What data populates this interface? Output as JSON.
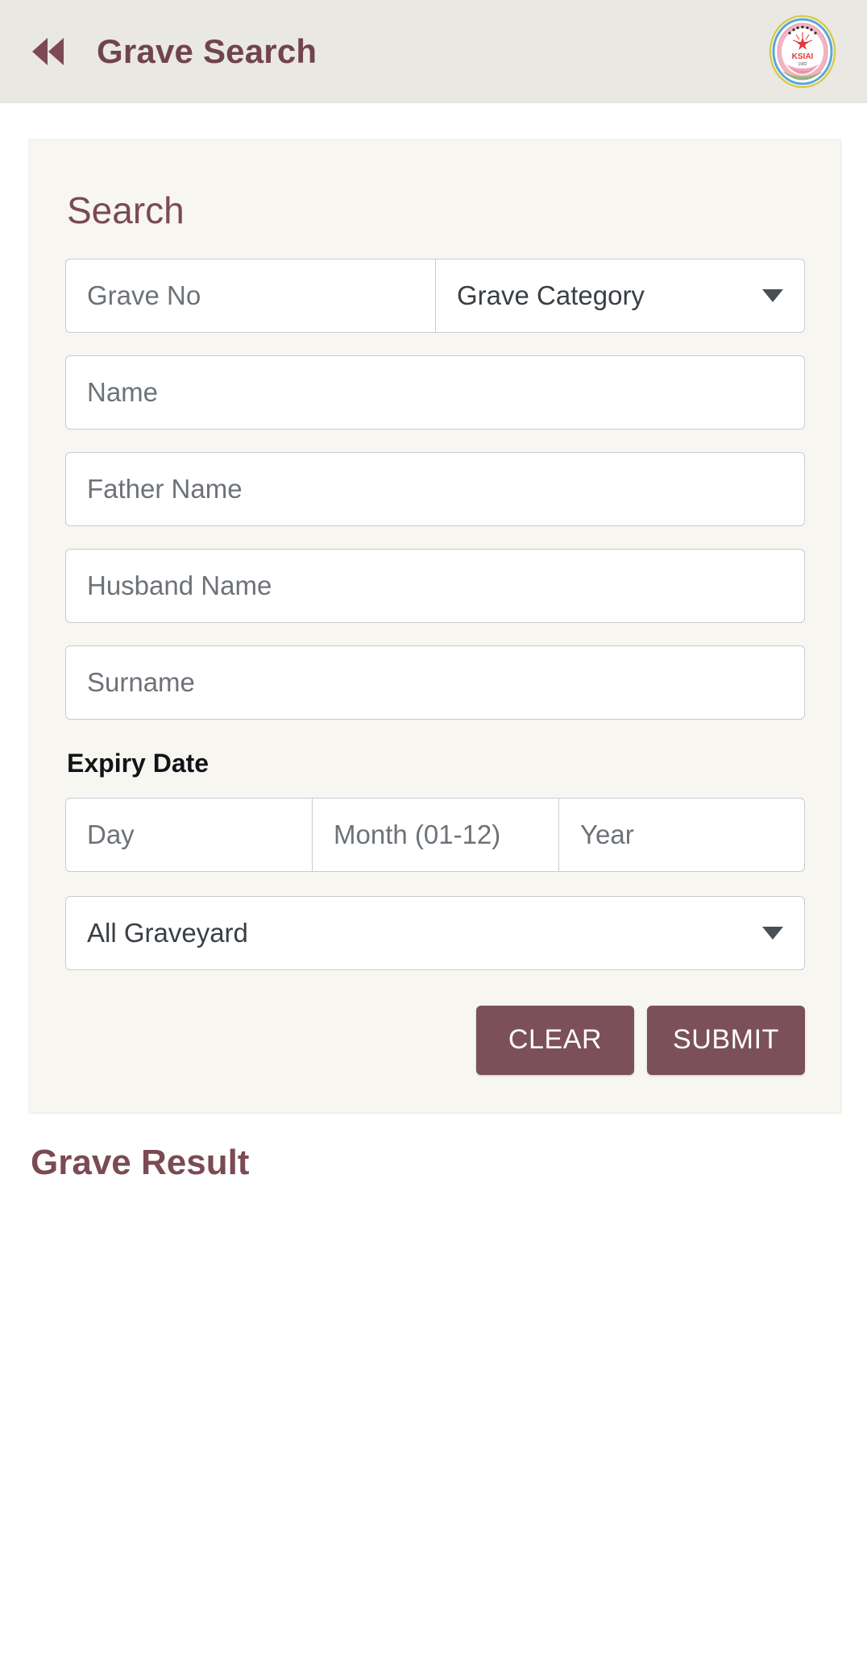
{
  "appbar": {
    "back_icon": "rewind-back-icon",
    "title": "Grave Search",
    "logo_icon": "organization-logo",
    "logo_text": "KSIAI",
    "logo_year": "1982"
  },
  "search_card": {
    "title": "Search",
    "fields": {
      "grave_no": {
        "placeholder": "Grave No",
        "value": ""
      },
      "grave_category": {
        "selected": "Grave Category"
      },
      "name": {
        "placeholder": "Name",
        "value": ""
      },
      "father_name": {
        "placeholder": "Father Name",
        "value": ""
      },
      "husband_name": {
        "placeholder": "Husband Name",
        "value": ""
      },
      "surname": {
        "placeholder": "Surname",
        "value": ""
      }
    },
    "expiry_date": {
      "label": "Expiry Date",
      "day": {
        "placeholder": "Day",
        "value": ""
      },
      "month": {
        "placeholder": "Month (01-12)",
        "value": ""
      },
      "year": {
        "placeholder": "Year",
        "value": ""
      }
    },
    "graveyard": {
      "selected": "All Graveyard"
    },
    "buttons": {
      "clear": "CLEAR",
      "submit": "SUBMIT"
    }
  },
  "result": {
    "title": "Grave Result",
    "rows": []
  },
  "colors": {
    "accent": "#7b4a52",
    "button": "#7b5058",
    "appbar_bg": "#eae8e3",
    "card_bg": "#f8f6f1",
    "input_border": "#c9cbd2",
    "placeholder": "#6d7278",
    "page_bg": "#ffffff"
  }
}
